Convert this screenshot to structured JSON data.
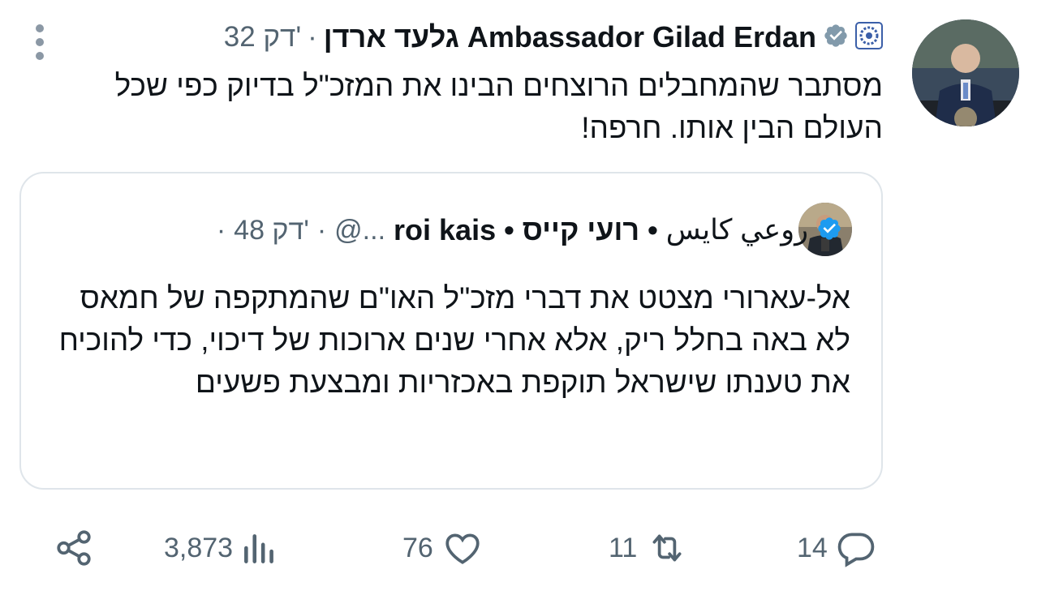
{
  "tweet": {
    "author_name": "גלעד ארדן Ambassador Gilad Erdan",
    "separator": "·",
    "time": "32 דק'",
    "text": "מסתבר שהמחבלים הרוצחים הבינו את המזכ\"ל בדיוק כפי שכל העולם הבין אותו. חרפה!"
  },
  "quote": {
    "display_name": "روعي كايس",
    "author_name": "roi kais • רועי קייס •",
    "handle": "@...",
    "time": "48 דק'",
    "text": "אל-עארורי מצטט את דברי מזכ\"ל האו\"ם שהמתקפה של חמאס לא באה בחלל ריק, אלא אחרי שנים ארוכות של דיכוי, כדי להוכיח את טענתו שישראל תוקפת באכזריות ומבצעת פשעים"
  },
  "actions": {
    "replies": "14",
    "retweets": "11",
    "likes": "76",
    "views": "3,873"
  },
  "icons": {
    "verified": "verified-badge-icon",
    "un": "un-emblem-icon",
    "more": "more-icon",
    "reply": "reply-icon",
    "retweet": "retweet-icon",
    "like": "heart-icon",
    "views": "views-icon",
    "share": "share-icon"
  },
  "colors": {
    "verified": "#1d9bf0",
    "verified_gray": "#829aab",
    "text": "#0f1419",
    "muted": "#536471",
    "border": "#dfe5ea"
  }
}
